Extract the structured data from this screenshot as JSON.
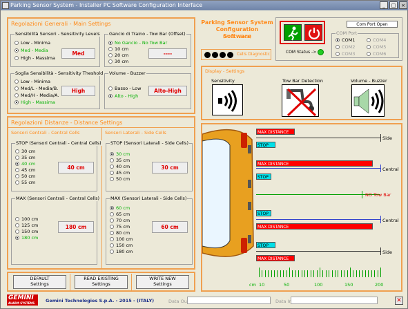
{
  "window": {
    "title": "Parking Sensor System - Installer PC Software Configuration Interface"
  },
  "header": {
    "app_title": "Parking Sensor System\nConfiguration Software",
    "version": "(V0.1 - Beta)",
    "cells_label": "Cells Diagnostic",
    "com_port_open": "Com Port Open",
    "com_port_title": "COM Port",
    "com_ports": [
      "COM1",
      "COM2",
      "COM3",
      "COM4",
      "COM5",
      "COM6"
    ],
    "com_status_label": "COM Status ->"
  },
  "general": {
    "title": "Regolazioni Generali - Main Settings",
    "sensitivity": {
      "title": "Sensibilità Sensori - Sensitivity Levels",
      "options": [
        "Low - Minima",
        "Med - Media",
        "High - Massima"
      ],
      "value": "Med"
    },
    "towbar": {
      "title": "Gancio di Traino - Tow Bar (Offset)",
      "options": [
        "No Gancio - No Tow Bar",
        "10 cm",
        "20 cm",
        "30 cm"
      ],
      "value": "----"
    },
    "threshold": {
      "title": "Soglia Sensibilità - Sensitivity Theshold",
      "options": [
        "Low - Minima",
        "Med/L - Media/B.",
        "Med/H - Media/A.",
        "High - Massima"
      ],
      "value": "High"
    },
    "buzzer": {
      "title": "Volume - Buzzer",
      "options": [
        "Basso - Low",
        "Alto - High"
      ],
      "value": "Alto-High"
    }
  },
  "distance": {
    "title": "Regolazioni Distanze - Distance Settings",
    "central_header": "Sensori Centrali - Central Cells",
    "side_header": "Sensori Laterali - Side Cells",
    "stop_central": {
      "title": "STOP (Sensori Centrali - Central Cells)",
      "options": [
        "30 cm",
        "35 cm",
        "40 cm",
        "45 cm",
        "50 cm",
        "55 cm"
      ],
      "value": "40 cm"
    },
    "stop_side": {
      "title": "STOP (Sensori Laterali - Side Cells)",
      "options": [
        "30 cm",
        "35 cm",
        "40 cm",
        "45 cm",
        "50 cm"
      ],
      "value": "30 cm"
    },
    "max_central": {
      "title": "MAX (Sensori Centrali - Central Cells)",
      "options": [
        "100 cm",
        "125 cm",
        "150 cm",
        "180 cm"
      ],
      "value": "180 cm"
    },
    "max_side": {
      "title": "MAX (Sensori Laterali - Side Cells)",
      "options": [
        "60 cm",
        "65 cm",
        "70 cm",
        "75 cm",
        "80 cm",
        "100 cm",
        "150 cm",
        "180 cm"
      ],
      "value": "60 cm"
    }
  },
  "buttons": {
    "default": "DEFAULT\nSettings",
    "read": "READ EXISTING\nSettings",
    "write": "WRITE NEW\nSettings"
  },
  "display": {
    "title": "Display - Settings",
    "sensitivity": "Sensitivity",
    "towbar": "Tow Bar Detection",
    "buzzer": "Volume - Buzzer",
    "max_distance": "MAX DISTANCE",
    "stop": "STOP",
    "side": "Side",
    "central": "Central",
    "no_tow_bar": "NO Tow Bar",
    "scale_unit": "cm",
    "scale": [
      "10",
      "50",
      "100",
      "150",
      "200"
    ]
  },
  "footer": {
    "company": "Gemini Technologies S.p.A. - 2015 - (ITALY)",
    "logo": "GEMINI",
    "logo_sub": "ALARM SYSTEMS",
    "data_out": "Data Out",
    "data_in": "Data In"
  },
  "colors": {
    "accent": "#ff8a1a",
    "value_red": "#e00000"
  }
}
